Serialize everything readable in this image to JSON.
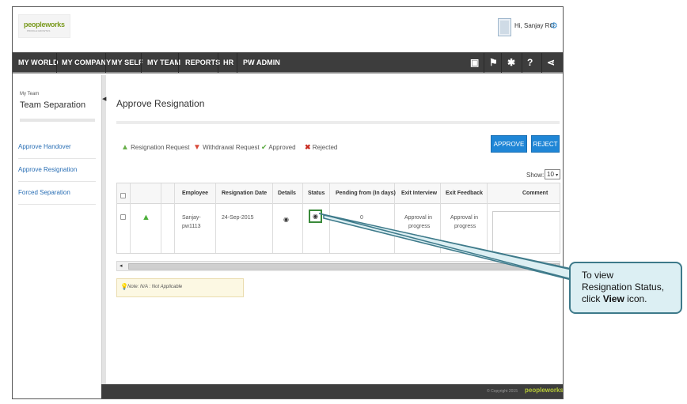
{
  "header": {
    "logo_text": "peopleworks",
    "logo_sub": "PROFILE GROWTHS",
    "greeting": "Hi, Sanjay RO"
  },
  "nav": {
    "items": [
      "MY WORLD",
      "MY COMPANY",
      "MY SELF",
      "MY TEAM",
      "REPORTS",
      "HR",
      "PW ADMIN"
    ]
  },
  "sidebar": {
    "subtitle": "My Team",
    "title": "Team Separation",
    "links": [
      "Approve Handover",
      "Approve Resignation",
      "Forced Separation"
    ]
  },
  "main": {
    "page_title": "Approve Resignation",
    "legend": {
      "resignation_request": "Resignation Request",
      "withdrawal_request": "Withdrawal Request",
      "approved": "Approved",
      "rejected": "Rejected"
    },
    "buttons": {
      "approve": "APPROVE",
      "reject": "REJECT"
    },
    "show_label": "Show:",
    "show_value": "10",
    "table": {
      "headers": {
        "employee": "Employee",
        "resignation_date": "Resignation Date",
        "details": "Details",
        "status": "Status",
        "pending_from": "Pending from (In days)",
        "exit_interview": "Exit Interview",
        "exit_feedback": "Exit Feedback",
        "comment": "Comment"
      },
      "rows": [
        {
          "employee_line1": "Sanjay-",
          "employee_line2": "pw1113",
          "resignation_date": "24-Sep-2015",
          "pending_from": "0",
          "exit_interview_line1": "Approval in",
          "exit_interview_line2": "progress",
          "exit_feedback_line1": "Approval in",
          "exit_feedback_line2": "progress"
        }
      ]
    },
    "note": "Note: N/A : Not Applicable"
  },
  "footer": {
    "copyright": "© Copyright 2015",
    "logo": "peopleworks"
  },
  "callout": {
    "line1": "To view",
    "line2": "Resignation Status,",
    "line3_prefix": "click",
    "line3_bold": "View",
    "line3_suffix": "icon."
  },
  "colors": {
    "accent_blue": "#1f86d6",
    "navbar": "#3d3d3d",
    "callout_fill": "#dceff3",
    "callout_border": "#3e7a8a",
    "highlight_green": "#3a8a3a"
  }
}
